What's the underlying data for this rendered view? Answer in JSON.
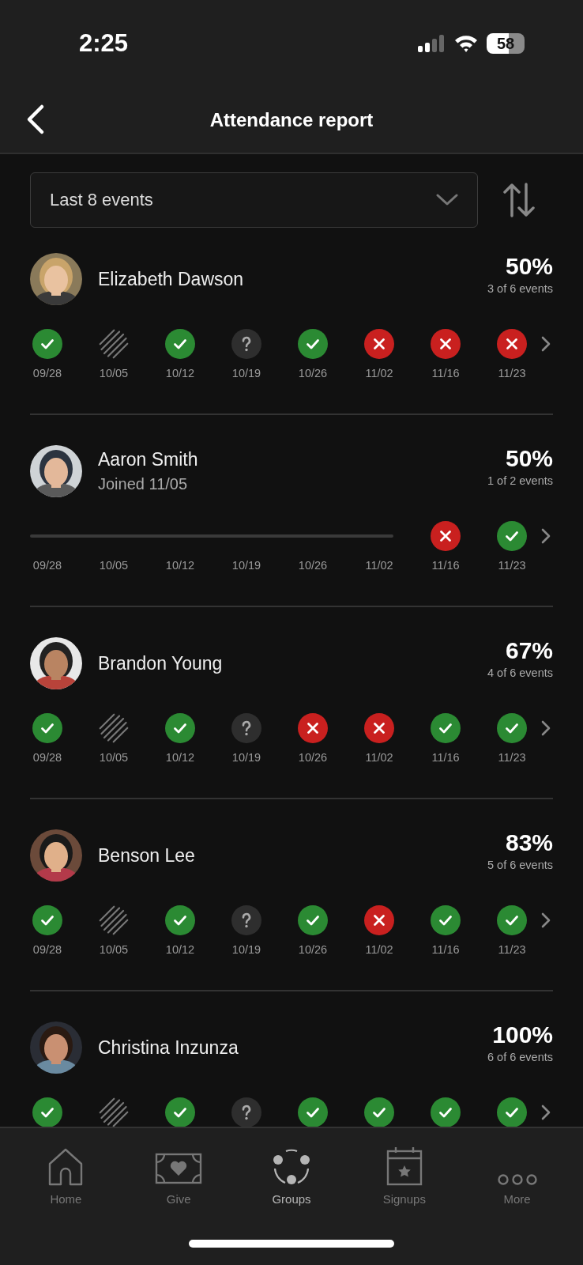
{
  "status_bar": {
    "time": "2:25",
    "battery": "58"
  },
  "header": {
    "title": "Attendance report"
  },
  "filter": {
    "value": "Last 8 events"
  },
  "people": [
    {
      "name": "Elizabeth Dawson",
      "percent": "50%",
      "summary": "3 of 6 events",
      "events": [
        {
          "kind": "present",
          "date": "09/28"
        },
        {
          "kind": "excused",
          "date": "10/05"
        },
        {
          "kind": "present",
          "date": "10/12"
        },
        {
          "kind": "unknown",
          "date": "10/19"
        },
        {
          "kind": "present",
          "date": "10/26"
        },
        {
          "kind": "absent",
          "date": "11/02"
        },
        {
          "kind": "absent",
          "date": "11/16"
        },
        {
          "kind": "absent",
          "date": "11/23"
        }
      ]
    },
    {
      "name": "Aaron Smith",
      "note": "Joined 11/05",
      "percent": "50%",
      "summary": "1 of 2 events",
      "events": [
        {
          "kind": "none",
          "date": "09/28"
        },
        {
          "kind": "none",
          "date": "10/05"
        },
        {
          "kind": "none",
          "date": "10/12"
        },
        {
          "kind": "none",
          "date": "10/19"
        },
        {
          "kind": "none",
          "date": "10/26"
        },
        {
          "kind": "none",
          "date": "11/02"
        },
        {
          "kind": "absent",
          "date": "11/16"
        },
        {
          "kind": "present",
          "date": "11/23"
        }
      ]
    },
    {
      "name": "Brandon Young",
      "percent": "67%",
      "summary": "4 of 6 events",
      "events": [
        {
          "kind": "present",
          "date": "09/28"
        },
        {
          "kind": "excused",
          "date": "10/05"
        },
        {
          "kind": "present",
          "date": "10/12"
        },
        {
          "kind": "unknown",
          "date": "10/19"
        },
        {
          "kind": "absent",
          "date": "10/26"
        },
        {
          "kind": "absent",
          "date": "11/02"
        },
        {
          "kind": "present",
          "date": "11/16"
        },
        {
          "kind": "present",
          "date": "11/23"
        }
      ]
    },
    {
      "name": "Benson Lee",
      "percent": "83%",
      "summary": "5 of 6 events",
      "events": [
        {
          "kind": "present",
          "date": "09/28"
        },
        {
          "kind": "excused",
          "date": "10/05"
        },
        {
          "kind": "present",
          "date": "10/12"
        },
        {
          "kind": "unknown",
          "date": "10/19"
        },
        {
          "kind": "present",
          "date": "10/26"
        },
        {
          "kind": "absent",
          "date": "11/02"
        },
        {
          "kind": "present",
          "date": "11/16"
        },
        {
          "kind": "present",
          "date": "11/23"
        }
      ]
    },
    {
      "name": "Christina Inzunza",
      "percent": "100%",
      "summary": "6 of 6 events",
      "events": [
        {
          "kind": "present"
        },
        {
          "kind": "excused"
        },
        {
          "kind": "present"
        },
        {
          "kind": "unknown"
        },
        {
          "kind": "present"
        },
        {
          "kind": "present"
        },
        {
          "kind": "present"
        },
        {
          "kind": "present"
        }
      ]
    }
  ],
  "tabs": [
    {
      "label": "Home",
      "selected": false
    },
    {
      "label": "Give",
      "selected": false
    },
    {
      "label": "Groups",
      "selected": true
    },
    {
      "label": "Signups",
      "selected": false
    },
    {
      "label": "More",
      "selected": false
    }
  ]
}
